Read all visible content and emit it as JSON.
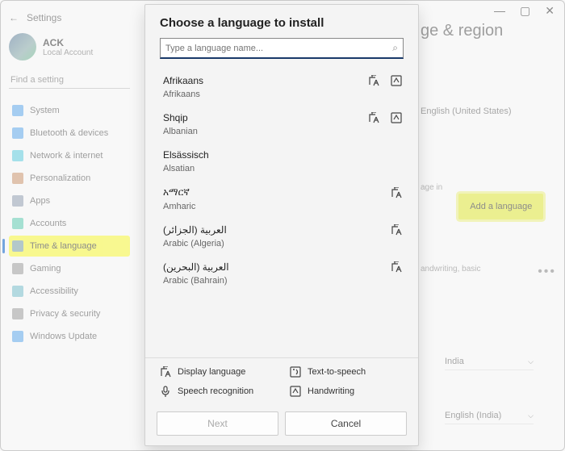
{
  "window": {
    "title": "Settings"
  },
  "profile": {
    "name": "ACK",
    "sub": "Local Account"
  },
  "search_placeholder": "Find a setting",
  "nav": [
    {
      "label": "System",
      "icon": "#3c96e8"
    },
    {
      "label": "Bluetooth & devices",
      "icon": "#3c96e8"
    },
    {
      "label": "Network & internet",
      "icon": "#3cc0d8"
    },
    {
      "label": "Personalization",
      "icon": "#c08050"
    },
    {
      "label": "Apps",
      "icon": "#7a8aa0"
    },
    {
      "label": "Accounts",
      "icon": "#3cc0a0"
    },
    {
      "label": "Time & language",
      "icon": "#5b8bc0",
      "active": true
    },
    {
      "label": "Gaming",
      "icon": "#888"
    },
    {
      "label": "Accessibility",
      "icon": "#5bb0c0"
    },
    {
      "label": "Privacy & security",
      "icon": "#888"
    },
    {
      "label": "Windows Update",
      "icon": "#3c96e8"
    }
  ],
  "right": {
    "title_fragment": "ge & region",
    "display_lang": "English (United States)",
    "add_button": "Add a language",
    "caption_fragment": "age in",
    "features": "andwriting, basic",
    "country": "India",
    "format": "English (India)"
  },
  "dialog": {
    "title": "Choose a language to install",
    "search_placeholder": "Type a language name...",
    "languages": [
      {
        "native": "Afrikaans",
        "english": "Afrikaans",
        "disp": true,
        "hand": true
      },
      {
        "native": "Shqip",
        "english": "Albanian",
        "disp": true,
        "hand": true
      },
      {
        "native": "Elsässisch",
        "english": "Alsatian"
      },
      {
        "native": "አማርኛ",
        "english": "Amharic",
        "disp": true
      },
      {
        "native": "العربية (الجزائر)",
        "english": "Arabic (Algeria)",
        "disp": true
      },
      {
        "native": "العربية (البحرين)",
        "english": "Arabic (Bahrain)",
        "disp": true
      }
    ],
    "legend": {
      "display": "Display language",
      "tts": "Text-to-speech",
      "speech": "Speech recognition",
      "hand": "Handwriting"
    },
    "next": "Next",
    "cancel": "Cancel"
  }
}
